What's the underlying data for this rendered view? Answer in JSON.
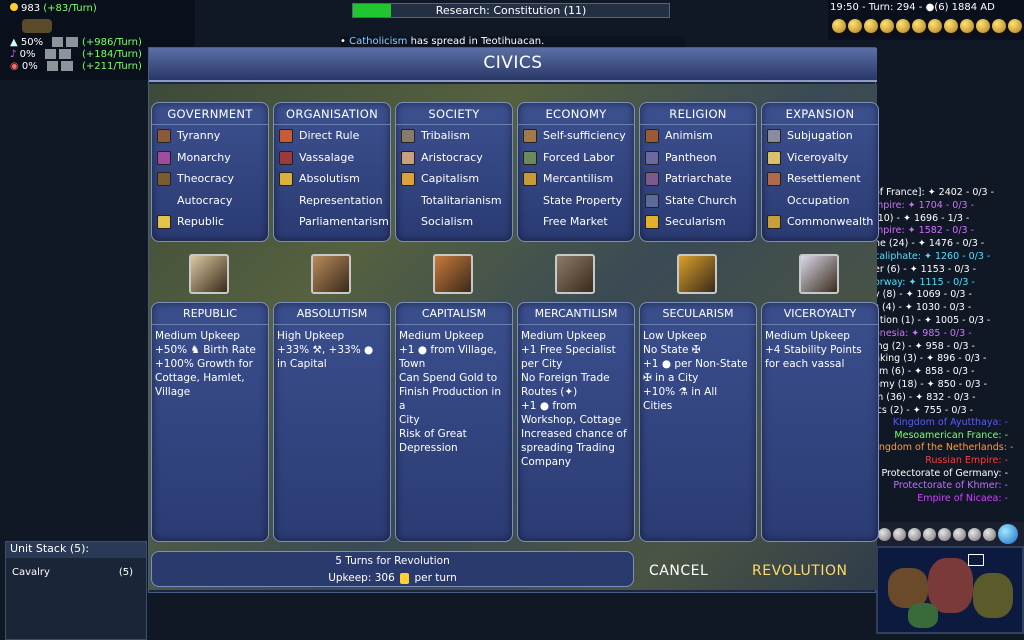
{
  "hud": {
    "gold": "983",
    "gold_rate": "(+83/Turn)",
    "rates": [
      {
        "pct": "50%",
        "turn": "(+986/Turn)",
        "color": "#7cff6a"
      },
      {
        "pct": "0%",
        "turn": "(+184/Turn)",
        "color": "#7cff6a"
      },
      {
        "pct": "0%",
        "turn": "(+211/Turn)",
        "color": "#7cff6a"
      }
    ],
    "research": "Research: Constitution (11)",
    "research_progress": 0.12,
    "message_bullet": "•",
    "message_highlight": "Catholicism",
    "message_rest": "has spread in Teotihuacan.",
    "top_right": "19:50 - Turn: 294 - ●(6) 1884 AD"
  },
  "score": [
    "of France]: ✦ 2402 - 0/3 -",
    "mpire: ✦ 1704 - 0/3 -",
    "(10) - ✦ 1696 - 1/3 -",
    "mpire: ✦ 1582 - 0/3 -",
    "ne (24) - ✦ 1476 - 0/3 -",
    "caliphate: ✦ 1260 - 0/3 -",
    "er (6) - ✦ 1153 - 0/3 -",
    "orway: ✦ 1115 - 0/3 -",
    "y (8) - ✦ 1069 - 0/3 -",
    "s (4) - ✦ 1030 - 0/3 -",
    "ation (1) - ✦ 1005 - 0/3 -",
    "onesia: ✦ 985 - 0/3 -",
    "ing (2) - ✦ 958 - 0/3 -",
    "nking (3) - ✦ 896 - 0/3 -",
    "sm (6) - ✦ 858 - 0/3 -",
    "omy (18) - ✦ 850 - 0/3 -",
    "m (36) - ✦ 832 - 0/3 -",
    "ics (2) - ✦ 755 - 0/3 -"
  ],
  "score_colors": [
    "#fff",
    "#d070ff",
    "#fff",
    "#d070ff",
    "#fff",
    "#4fe0ff",
    "#fff",
    "#4fe0ff",
    "#fff",
    "#fff",
    "#fff",
    "#d070ff",
    "#fff",
    "#fff",
    "#fff",
    "#fff",
    "#fff",
    "#fff"
  ],
  "score2": [
    {
      "text": "Kingdom of Ayutthaya: -",
      "color": "#5a5aff"
    },
    {
      "text": "Mesoamerican France: -",
      "color": "#7cff6a"
    },
    {
      "text": "Kingdom of the Netherlands: -",
      "color": "#ff9a3a"
    },
    {
      "text": "Russian Empire: -",
      "color": "#ff3a3a"
    },
    {
      "text": "Protectorate of Germany: -",
      "color": "#ffffff"
    },
    {
      "text": "Protectorate of Khmer: -",
      "color": "#c070ff"
    },
    {
      "text": "Empire of Nicaea: -",
      "color": "#d040ff"
    }
  ],
  "unit_stack": {
    "title": "Unit Stack (5):",
    "unit": "Cavalry",
    "count": "(5)"
  },
  "civics": {
    "title": "CIVICS",
    "categories": [
      {
        "name": "GOVERNMENT",
        "items": [
          {
            "label": "Tyranny",
            "icon": "tyranny-icon",
            "color": "#8c5a3a"
          },
          {
            "label": "Monarchy",
            "icon": "monarchy-icon",
            "color": "#a04aa0"
          },
          {
            "label": "Theocracy",
            "icon": "theocracy-icon",
            "color": "#7a5a30"
          },
          {
            "label": "Autocracy",
            "icon": "",
            "color": ""
          },
          {
            "label": "Republic",
            "icon": "republic-icon",
            "color": "#e3c14a"
          }
        ]
      },
      {
        "name": "ORGANISATION",
        "items": [
          {
            "label": "Direct Rule",
            "icon": "direct-rule-icon",
            "color": "#c85a3a"
          },
          {
            "label": "Vassalage",
            "icon": "vassalage-icon",
            "color": "#9a3a3a"
          },
          {
            "label": "Absolutism",
            "icon": "absolutism-icon",
            "color": "#d9b23a"
          },
          {
            "label": "Representation",
            "icon": "",
            "color": ""
          },
          {
            "label": "Parliamentarism",
            "icon": "",
            "color": ""
          }
        ]
      },
      {
        "name": "SOCIETY",
        "items": [
          {
            "label": "Tribalism",
            "icon": "tribalism-icon",
            "color": "#8a7a6a"
          },
          {
            "label": "Aristocracy",
            "icon": "aristocracy-icon",
            "color": "#c8a080"
          },
          {
            "label": "Capitalism",
            "icon": "capitalism-icon",
            "color": "#d9a23a"
          },
          {
            "label": "Totalitarianism",
            "icon": "",
            "color": ""
          },
          {
            "label": "Socialism",
            "icon": "",
            "color": ""
          }
        ]
      },
      {
        "name": "ECONOMY",
        "items": [
          {
            "label": "Self-sufficiency",
            "icon": "self-sufficiency-icon",
            "color": "#a07a4a"
          },
          {
            "label": "Forced Labor",
            "icon": "forced-labor-icon",
            "color": "#6a8a5a"
          },
          {
            "label": "Mercantilism",
            "icon": "mercantilism-icon",
            "color": "#c89a3a"
          },
          {
            "label": "State Property",
            "icon": "",
            "color": ""
          },
          {
            "label": "Free Market",
            "icon": "",
            "color": ""
          }
        ]
      },
      {
        "name": "RELIGION",
        "items": [
          {
            "label": "Animism",
            "icon": "animism-icon",
            "color": "#9a5a3a"
          },
          {
            "label": "Pantheon",
            "icon": "pantheon-icon",
            "color": "#6a6aa0"
          },
          {
            "label": "Patriarchate",
            "icon": "patriarchate-icon",
            "color": "#7a5a8a"
          },
          {
            "label": "State Church",
            "icon": "state-church-icon",
            "color": "#5a6a9a"
          },
          {
            "label": "Secularism",
            "icon": "secularism-icon",
            "color": "#e3b02a"
          }
        ]
      },
      {
        "name": "EXPANSION",
        "items": [
          {
            "label": "Subjugation",
            "icon": "subjugation-icon",
            "color": "#8a8aa0"
          },
          {
            "label": "Viceroyalty",
            "icon": "viceroyalty-icon",
            "color": "#d9c06a"
          },
          {
            "label": "Resettlement",
            "icon": "resettlement-icon",
            "color": "#b06a4a"
          },
          {
            "label": "Occupation",
            "icon": "",
            "color": ""
          },
          {
            "label": "Commonwealth",
            "icon": "commonwealth-icon",
            "color": "#c8a03a"
          }
        ]
      }
    ],
    "selected_images": [
      {
        "icon": "republic-scroll-icon",
        "color": "#d9c8a0"
      },
      {
        "icon": "absolutism-gavel-icon",
        "color": "#b88a5a"
      },
      {
        "icon": "capitalism-coin-icon",
        "color": "#c87a3a"
      },
      {
        "icon": "mercantilism-market-icon",
        "color": "#8a7a6a"
      },
      {
        "icon": "secularism-figure-icon",
        "color": "#d9a02a"
      },
      {
        "icon": "viceroyalty-flag-icon",
        "color": "#d9d9e8"
      }
    ],
    "details": [
      {
        "name": "REPUBLIC",
        "upkeep": "Medium Upkeep",
        "lines": [
          "+50% ♞ Birth Rate",
          "+100% Growth for",
          "Cottage, Hamlet,",
          "Village"
        ]
      },
      {
        "name": "ABSOLUTISM",
        "upkeep": "High Upkeep",
        "lines": [
          "+33% ⚒, +33% ●",
          "in Capital"
        ]
      },
      {
        "name": "CAPITALISM",
        "upkeep": "Medium Upkeep",
        "lines": [
          "+1 ● from Village,",
          "Town",
          "Can Spend Gold to",
          "Finish Production in a",
          "City",
          "Risk of Great",
          "Depression"
        ]
      },
      {
        "name": "MERCANTILISM",
        "upkeep": "Medium Upkeep",
        "lines": [
          "+1 Free Specialist",
          "per City",
          "No Foreign Trade",
          "Routes (✦)",
          "+1 ● from",
          "Workshop, Cottage",
          "Increased chance of",
          "spreading Trading",
          "Company"
        ]
      },
      {
        "name": "SECULARISM",
        "upkeep": "Low Upkeep",
        "lines": [
          "No State ✠",
          "+1 ● per Non-State",
          "✠ in a City",
          "+10% ⚗ in All",
          "Cities"
        ]
      },
      {
        "name": "VICEROYALTY",
        "upkeep": "Medium Upkeep",
        "lines": [
          "+4 Stability Points",
          "for each vassal"
        ]
      }
    ],
    "revolution_turns": "5 Turns for Revolution",
    "upkeep_label": "Upkeep: 306",
    "upkeep_suffix": "per turn",
    "cancel": "CANCEL",
    "revolution": "REVOLUTION"
  }
}
